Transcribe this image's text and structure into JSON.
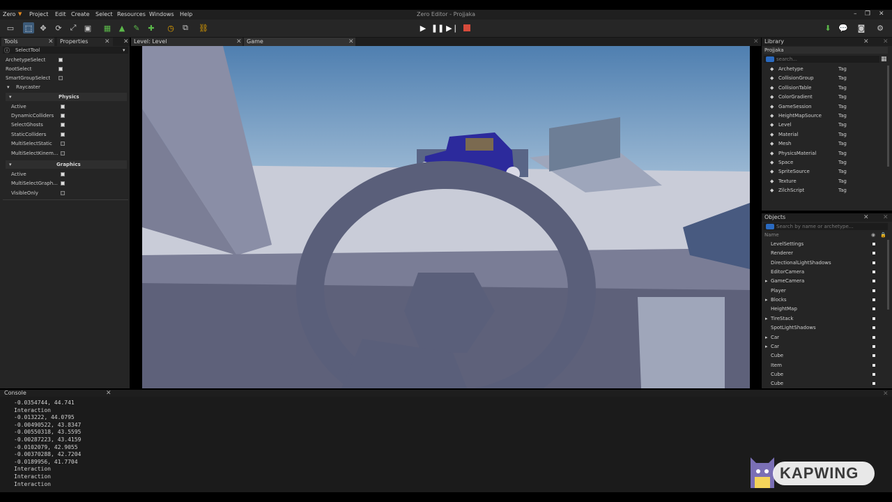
{
  "menu": {
    "logo": "Zero",
    "items": [
      "Project",
      "Edit",
      "Create",
      "Select",
      "Resources",
      "Windows",
      "Help"
    ],
    "title": "Zero Editor - Projjaka"
  },
  "panels": {
    "tools_tab": "Tools",
    "properties_tab": "Properties",
    "level_tab": "Level: Level",
    "game_tab": "Game",
    "library_tab": "Library",
    "objects_tab": "Objects",
    "console_tab": "Console"
  },
  "tools": {
    "dropdown": "SelectTool",
    "props": [
      {
        "label": "ArchetypeSelect",
        "checked": true
      },
      {
        "label": "RootSelect",
        "checked": true
      },
      {
        "label": "SmartGroupSelect",
        "checked": false
      }
    ],
    "raycaster_label": "Raycaster",
    "physics_title": "Physics",
    "physics": [
      {
        "label": "Active",
        "checked": true
      },
      {
        "label": "DynamicColliders",
        "checked": true
      },
      {
        "label": "SelectGhosts",
        "checked": true
      },
      {
        "label": "StaticColliders",
        "checked": true
      },
      {
        "label": "MultiSelectStatic",
        "checked": false
      },
      {
        "label": "MultiSelectKinem...",
        "checked": false
      }
    ],
    "graphics_title": "Graphics",
    "graphics": [
      {
        "label": "Active",
        "checked": true
      },
      {
        "label": "MultiSelectGraph...",
        "checked": true
      },
      {
        "label": "VisibleOnly",
        "checked": false
      }
    ]
  },
  "library": {
    "project": "Projjaka",
    "search_placeholder": "search...",
    "items": [
      {
        "name": "Archetype",
        "tag": "Tag"
      },
      {
        "name": "CollisionGroup",
        "tag": "Tag"
      },
      {
        "name": "CollisionTable",
        "tag": "Tag"
      },
      {
        "name": "ColorGradient",
        "tag": "Tag"
      },
      {
        "name": "GameSession",
        "tag": "Tag"
      },
      {
        "name": "HeightMapSource",
        "tag": "Tag"
      },
      {
        "name": "Level",
        "tag": "Tag"
      },
      {
        "name": "Material",
        "tag": "Tag"
      },
      {
        "name": "Mesh",
        "tag": "Tag"
      },
      {
        "name": "PhysicsMaterial",
        "tag": "Tag"
      },
      {
        "name": "Space",
        "tag": "Tag"
      },
      {
        "name": "SpriteSource",
        "tag": "Tag"
      },
      {
        "name": "Texture",
        "tag": "Tag"
      },
      {
        "name": "ZilchScript",
        "tag": "Tag"
      }
    ]
  },
  "objects": {
    "search_placeholder": "Search by name or archetype...",
    "name_header": "Name",
    "items": [
      {
        "name": "LevelSettings",
        "expandable": false
      },
      {
        "name": "Renderer",
        "expandable": false
      },
      {
        "name": "DirectionalLightShadows",
        "expandable": false
      },
      {
        "name": "EditorCamera",
        "expandable": false
      },
      {
        "name": "GameCamera",
        "expandable": true
      },
      {
        "name": "Player",
        "expandable": false
      },
      {
        "name": "Blocks",
        "expandable": true
      },
      {
        "name": "HeightMap",
        "expandable": false
      },
      {
        "name": "TireStack",
        "expandable": true
      },
      {
        "name": "SpotLightShadows",
        "expandable": false
      },
      {
        "name": "Car",
        "expandable": true
      },
      {
        "name": "Car",
        "expandable": true
      },
      {
        "name": "Cube",
        "expandable": false
      },
      {
        "name": "Item",
        "expandable": false
      },
      {
        "name": "Cube",
        "expandable": false
      },
      {
        "name": "Cube",
        "expandable": false
      }
    ]
  },
  "console": {
    "lines": [
      "-0.0354744, 44.741",
      "Interaction",
      "-0.013222, 44.0795",
      "-0.00490522, 43.8347",
      "-0.00550318, 43.5595",
      "-0.00287223, 43.4159",
      "-0.0102079, 42.9055",
      "-0.00370288, 42.7204",
      "-0.0189956, 41.7704",
      "Interaction",
      "Interaction",
      "Interaction"
    ]
  },
  "watermark": "KAPWING",
  "colors": {
    "panel_bg": "#252525",
    "accent_blue": "#2a6ac0",
    "stop_red": "#d64b3b",
    "car_blue": "#2c2a9c",
    "sky_top": "#4f7fb0"
  }
}
